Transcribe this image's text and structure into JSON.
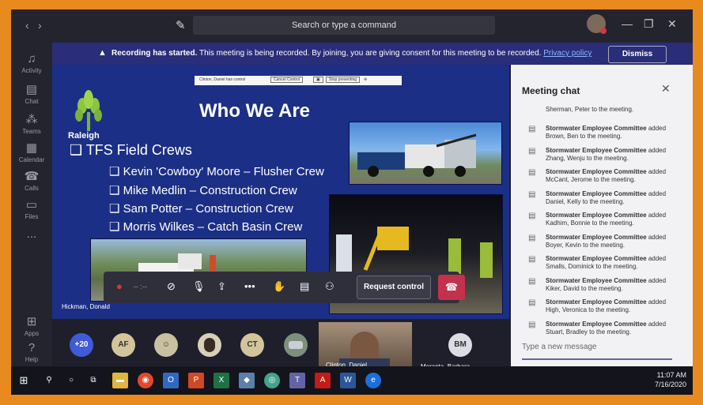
{
  "titlebar": {
    "search_placeholder": "Search or type a command",
    "back_icon": "‹",
    "forward_icon": "›",
    "minimize": "—",
    "maximize": "❐",
    "close": "✕"
  },
  "rail": [
    {
      "label": "Activity",
      "icon": "bell-icon"
    },
    {
      "label": "Chat",
      "icon": "chat-icon"
    },
    {
      "label": "Teams",
      "icon": "teams-icon"
    },
    {
      "label": "Calendar",
      "icon": "calendar-icon"
    },
    {
      "label": "Calls",
      "icon": "phone-icon"
    },
    {
      "label": "Files",
      "icon": "file-icon"
    },
    {
      "label": "...",
      "icon": "more-icon"
    },
    {
      "label": "Apps",
      "icon": "apps-icon"
    },
    {
      "label": "Help",
      "icon": "help-icon"
    }
  ],
  "banner": {
    "bold": "Recording has started.",
    "message": " This meeting is being recorded. By joining, you are giving consent for this meeting to be recorded. ",
    "link": "Privacy policy",
    "dismiss": "Dismiss"
  },
  "slide": {
    "control_bar": {
      "text": "Clinton, Daniel has control",
      "cancel": "Cancel Control",
      "stop": "Stop presenting"
    },
    "logo_text": "Raleigh",
    "title": "Who We Are",
    "heading": "❑ TFS Field Crews",
    "crews": [
      "❑  Kevin 'Cowboy' Moore – Flusher Crew",
      "❑  Mike Medlin – Construction Crew",
      "❑  Sam Potter – Construction Crew",
      "❑  Morris Wilkes – Catch Basin Crew"
    ],
    "presenter_label": "Hickman, Donald"
  },
  "callbar": {
    "request_control": "Request control",
    "timer": "-- :--"
  },
  "chat": {
    "title": "Meeting chat",
    "first_line": "Sherman, Peter to the meeting.",
    "sender": "Stormwater Employee Committee",
    "items": [
      {
        "name": "Brown, Ben"
      },
      {
        "name": "Zhang, Wenju"
      },
      {
        "name": "McCant, Jerome"
      },
      {
        "name": "Daniel, Kelly"
      },
      {
        "name": "Kadhim, Bonnie"
      },
      {
        "name": "Boyer, Kevin"
      },
      {
        "name": "Smalls, Dominick"
      },
      {
        "name": "Kiker, David"
      },
      {
        "name": "High, Veronica"
      },
      {
        "name": "Stuart, Bradley"
      }
    ],
    "added_word": " added",
    "suffix": " to the meeting.",
    "placeholder": "Type a new message"
  },
  "participants": {
    "overflow": "+20",
    "initials": [
      "AF",
      "CT"
    ],
    "bm": "BM",
    "video_name": "Clinton, Daniel",
    "bm_name": "Moranta, Barbara"
  },
  "taskbar": {
    "time": "11:07 AM",
    "date": "7/16/2020"
  },
  "colors": {
    "orange_frame": "#e98a1f",
    "slide_bg": "#1c2f86",
    "banner_bg": "#2a2d78",
    "hangup": "#c4314b",
    "accent": "#6264a7"
  }
}
